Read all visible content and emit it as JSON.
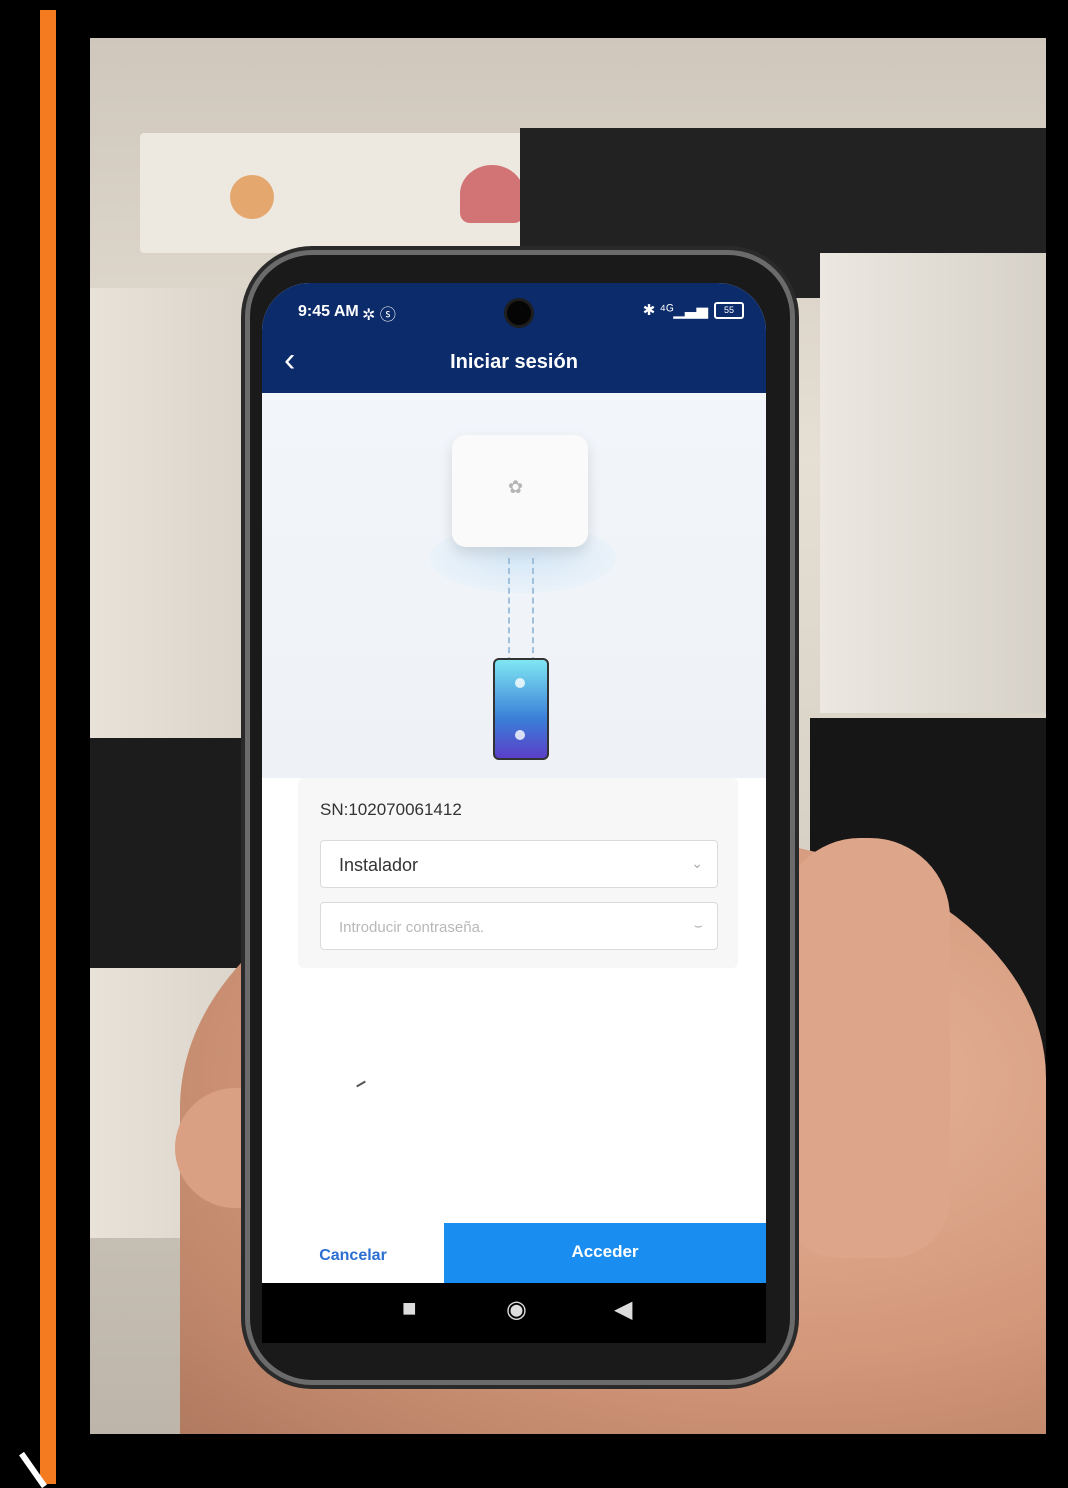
{
  "status": {
    "time": "9:45 AM",
    "left_icons": "✲ ⓢ",
    "right_icons": "✱ ⁴ᴳ▁▃▅",
    "battery": "55"
  },
  "appbar": {
    "back_icon": "chevron-left-icon",
    "title": "Iniciar sesión"
  },
  "form": {
    "serial": "SN:102070061412",
    "user_select": {
      "value": "Instalador"
    },
    "password": {
      "placeholder": "Introducir contraseña."
    }
  },
  "actions": {
    "cancel": "Cancelar",
    "access": "Acceder"
  },
  "colors": {
    "orange_bar": "#f47b20",
    "appbar": "#0c2b6a",
    "primary": "#1a8ef0",
    "cancel_text": "#2b6fd0"
  }
}
